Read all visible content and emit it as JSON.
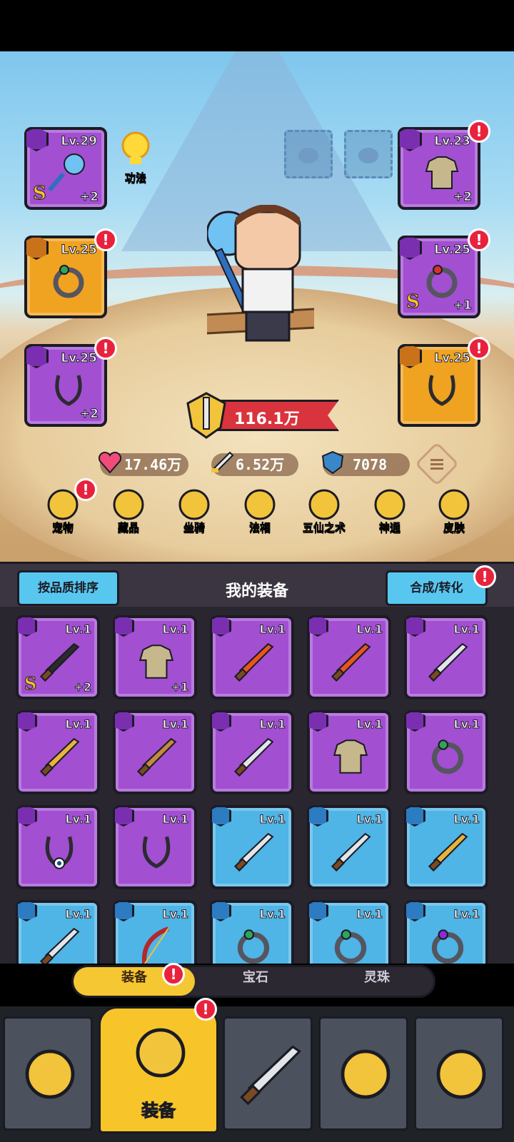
{
  "hero_panel": {
    "skill_label": "功法",
    "power": "116.1万",
    "stats": {
      "hp": "17.46万",
      "attack": "6.52万",
      "defense": "7078"
    },
    "equipped_left": [
      {
        "level": "Lv.29",
        "plus": "+2",
        "rarity": "purple",
        "s_mark": "S",
        "icon": "blue-orb-staff-icon",
        "alert": false
      },
      {
        "level": "Lv.25",
        "plus": "",
        "rarity": "orange",
        "s_mark": "",
        "icon": "jade-ring-icon",
        "alert": true
      },
      {
        "level": "Lv.25",
        "plus": "+2",
        "rarity": "purple",
        "s_mark": "",
        "icon": "cord-necklace-icon",
        "alert": true
      }
    ],
    "equipped_right": [
      {
        "level": "Lv.23",
        "plus": "+2",
        "rarity": "purple",
        "s_mark": "",
        "icon": "cloth-armor-icon",
        "alert": true
      },
      {
        "level": "Lv.25",
        "plus": "+1",
        "rarity": "purple",
        "s_mark": "S",
        "icon": "red-gem-ring-icon",
        "alert": true
      },
      {
        "level": "Lv.25",
        "plus": "",
        "rarity": "orange",
        "s_mark": "",
        "icon": "cord-necklace-icon",
        "alert": true
      }
    ],
    "menu": [
      {
        "label": "宠物",
        "icon": "pet-icon",
        "alert": true
      },
      {
        "label": "藏品",
        "icon": "treasure-chest-icon",
        "alert": false
      },
      {
        "label": "坐骑",
        "icon": "mount-icon",
        "alert": false
      },
      {
        "label": "法相",
        "icon": "golden-teapot-icon",
        "alert": false
      },
      {
        "label": "五仙之术",
        "icon": "scroll-icon",
        "alert": false
      },
      {
        "label": "神通",
        "icon": "spellbook-icon",
        "alert": false
      },
      {
        "label": "皮肤",
        "icon": "helmet-icon",
        "alert": false
      }
    ]
  },
  "bag": {
    "sort_button": "按品质排序",
    "title": "我的装备",
    "compose_button": "合成/转化",
    "items": [
      {
        "level": "Lv.1",
        "plus": "+2",
        "s_mark": "S",
        "rarity": "purple",
        "icon": "black-dagger-icon"
      },
      {
        "level": "Lv.1",
        "plus": "+1",
        "s_mark": "",
        "rarity": "purple",
        "icon": "cloth-armor-icon"
      },
      {
        "level": "Lv.1",
        "plus": "",
        "s_mark": "",
        "rarity": "purple",
        "icon": "flame-sword-icon"
      },
      {
        "level": "Lv.1",
        "plus": "",
        "s_mark": "",
        "rarity": "purple",
        "icon": "flame-sword-icon"
      },
      {
        "level": "Lv.1",
        "plus": "",
        "s_mark": "",
        "rarity": "purple",
        "icon": "steel-sword-icon"
      },
      {
        "level": "Lv.1",
        "plus": "",
        "s_mark": "",
        "rarity": "purple",
        "icon": "golden-sword-icon"
      },
      {
        "level": "Lv.1",
        "plus": "",
        "s_mark": "",
        "rarity": "purple",
        "icon": "bronze-spear-icon"
      },
      {
        "level": "Lv.1",
        "plus": "",
        "s_mark": "",
        "rarity": "purple",
        "icon": "jeweled-sword-icon"
      },
      {
        "level": "Lv.1",
        "plus": "",
        "s_mark": "",
        "rarity": "purple",
        "icon": "cloth-armor-icon"
      },
      {
        "level": "Lv.1",
        "plus": "",
        "s_mark": "",
        "rarity": "purple",
        "icon": "jade-ring-icon"
      },
      {
        "level": "Lv.1",
        "plus": "",
        "s_mark": "",
        "rarity": "purple",
        "icon": "eye-amulet-icon"
      },
      {
        "level": "Lv.1",
        "plus": "",
        "s_mark": "",
        "rarity": "purple",
        "icon": "cord-necklace-icon"
      },
      {
        "level": "Lv.1",
        "plus": "",
        "s_mark": "",
        "rarity": "blue",
        "icon": "steel-sword-icon"
      },
      {
        "level": "Lv.1",
        "plus": "",
        "s_mark": "",
        "rarity": "blue",
        "icon": "steel-sword-icon"
      },
      {
        "level": "Lv.1",
        "plus": "",
        "s_mark": "",
        "rarity": "blue",
        "icon": "golden-sword-icon"
      },
      {
        "level": "Lv.1",
        "plus": "",
        "s_mark": "",
        "rarity": "blue",
        "icon": "jeweled-sword-icon"
      },
      {
        "level": "Lv.1",
        "plus": "",
        "s_mark": "",
        "rarity": "blue",
        "icon": "serpent-bow-icon"
      },
      {
        "level": "Lv.1",
        "plus": "",
        "s_mark": "",
        "rarity": "blue",
        "icon": "jade-ring-icon"
      },
      {
        "level": "Lv.1",
        "plus": "",
        "s_mark": "",
        "rarity": "blue",
        "icon": "jade-ring-icon"
      },
      {
        "level": "Lv.1",
        "plus": "",
        "s_mark": "",
        "rarity": "blue",
        "icon": "amethyst-ring-icon"
      }
    ]
  },
  "tabs": [
    {
      "label": "装备",
      "active": true,
      "alert": true
    },
    {
      "label": "宝石",
      "active": false,
      "alert": false
    },
    {
      "label": "灵珠",
      "active": false,
      "alert": false
    }
  ],
  "nav": [
    {
      "label": "",
      "icon": "shop-icon",
      "active": false,
      "alert": false
    },
    {
      "label": "装备",
      "icon": "equipment-helmet-icon",
      "active": true,
      "alert": true
    },
    {
      "label": "",
      "icon": "crossed-swords-icon",
      "active": false,
      "alert": false
    },
    {
      "label": "",
      "icon": "upgrade-arrow-icon",
      "active": false,
      "alert": false
    },
    {
      "label": "",
      "icon": "treasure-chest-icon",
      "active": false,
      "alert": false
    }
  ],
  "alert_mark": "!",
  "colors": {
    "purple": "#a24fd2",
    "orange": "#f0a221",
    "blue": "#4fb4e6",
    "alert": "#e8223d",
    "accent_blue": "#58c7f0"
  }
}
